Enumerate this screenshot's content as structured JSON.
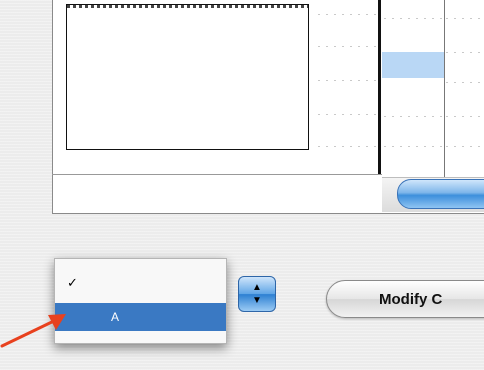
{
  "popup_menu": {
    "items": [
      {
        "check": "✓",
        "label": ""
      },
      {
        "check": "",
        "label": "A"
      }
    ]
  },
  "stepper": {
    "up": "▲",
    "down": "▼"
  },
  "modify_button": {
    "label": "Modify C"
  },
  "colors": {
    "selection": "#3a79c3",
    "highlight_cell": "#b9d7f5",
    "annotation_arrow": "#e8411e"
  }
}
